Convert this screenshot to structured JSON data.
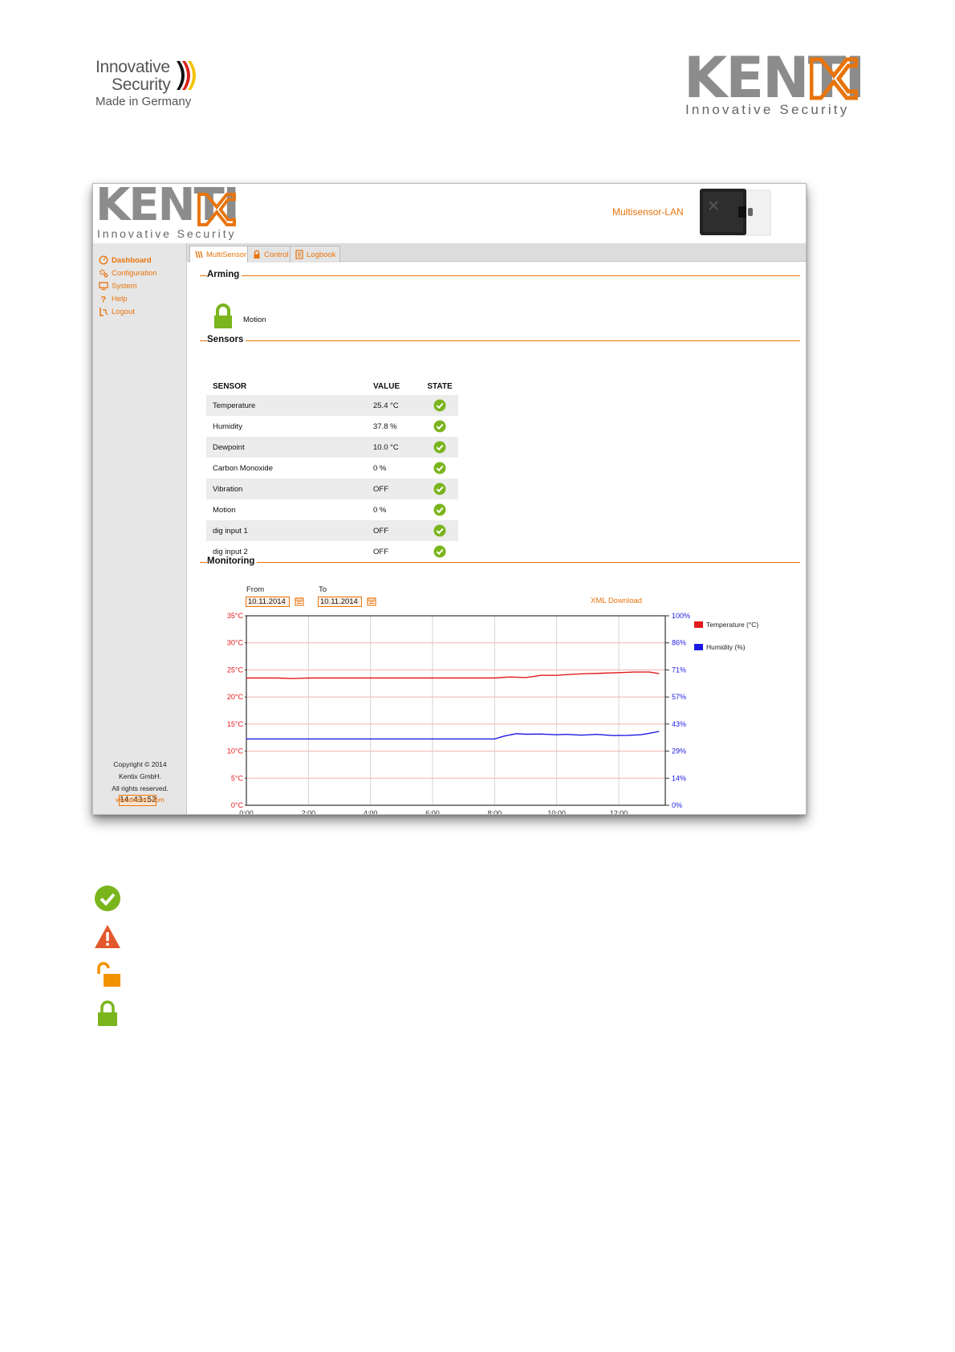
{
  "doc": {
    "left_logo": {
      "line1": "Innovative",
      "line2": "Security",
      "line3": "Made in Germany"
    },
    "right_logo": {
      "word": "KENTI",
      "tagline": "Innovative Security"
    }
  },
  "app": {
    "logo": {
      "word": "KENTI",
      "tagline": "Innovative Security"
    },
    "device_name": "Multisensor-LAN",
    "sidebar": {
      "items": [
        {
          "label": "Dashboard",
          "icon": "dashboard-icon",
          "active": true
        },
        {
          "label": "Configuration",
          "icon": "gears-icon",
          "active": false
        },
        {
          "label": "System",
          "icon": "monitor-icon",
          "active": false
        },
        {
          "label": "Help",
          "icon": "question-icon",
          "active": false
        },
        {
          "label": "Logout",
          "icon": "logout-icon",
          "active": false
        }
      ],
      "clock": "14:43:52",
      "copyright": [
        "Copyright © 2014",
        "Kentix GmbH.",
        "All rights reserved."
      ],
      "website": "www.kentix.com"
    },
    "tabs": [
      {
        "label": "MultiSensor",
        "icon": "signal-icon",
        "active": true
      },
      {
        "label": "Control",
        "icon": "lock-icon",
        "active": false
      },
      {
        "label": "Logbook",
        "icon": "book-icon",
        "active": false
      }
    ],
    "arming": {
      "title": "Arming",
      "item_label": "Motion",
      "state": "locked"
    },
    "sensors": {
      "title": "Sensors",
      "columns": [
        "SENSOR",
        "VALUE",
        "STATE"
      ],
      "rows": [
        {
          "sensor": "Temperature",
          "value": "25.4 °C",
          "state": "ok"
        },
        {
          "sensor": "Humidity",
          "value": "37.8 %",
          "state": "ok"
        },
        {
          "sensor": "Dewpoint",
          "value": "10.0 °C",
          "state": "ok"
        },
        {
          "sensor": "Carbon Monoxide",
          "value": "0 %",
          "state": "ok"
        },
        {
          "sensor": "Vibration",
          "value": "OFF",
          "state": "ok"
        },
        {
          "sensor": "Motion",
          "value": "0 %",
          "state": "ok"
        },
        {
          "sensor": "dig input 1",
          "value": "OFF",
          "state": "ok"
        },
        {
          "sensor": "dig input 2",
          "value": "OFF",
          "state": "ok"
        }
      ]
    },
    "monitoring": {
      "title": "Monitoring",
      "from_label": "From",
      "from_value": "10.11.2014",
      "to_label": "To",
      "to_value": "10.11.2014",
      "xml_download": "XML Download"
    },
    "colors": {
      "accent": "#e8740c",
      "ok_green": "#7ab51d",
      "temperature": "#e41a1c",
      "humidity": "#1a1ae4"
    }
  },
  "chart_data": {
    "type": "line",
    "x_ticks": [
      "0:00",
      "2:00",
      "4:00",
      "6:00",
      "8:00",
      "10:00",
      "12:00"
    ],
    "xlim": [
      0,
      13.5
    ],
    "y_left_ticks": [
      "0°C",
      "5°C",
      "10°C",
      "15°C",
      "20°C",
      "25°C",
      "30°C",
      "35°C"
    ],
    "y_left_lim": [
      0,
      35
    ],
    "y_right_ticks": [
      "0%",
      "14%",
      "29%",
      "43%",
      "57%",
      "71%",
      "86%",
      "100%"
    ],
    "y_right_lim": [
      0,
      100
    ],
    "grid": true,
    "legend_position": "right",
    "series": [
      {
        "name": "Temperature (°C)",
        "axis": "left",
        "color": "#e41a1c",
        "x": [
          0,
          1,
          1.5,
          2,
          3,
          4,
          5,
          6,
          7,
          8,
          8.5,
          9,
          9.5,
          10,
          10.5,
          11,
          11.5,
          12,
          12.5,
          13,
          13.3
        ],
        "y": [
          23.5,
          23.5,
          23.4,
          23.5,
          23.5,
          23.5,
          23.5,
          23.5,
          23.5,
          23.5,
          23.7,
          23.6,
          24.0,
          24.0,
          24.2,
          24.3,
          24.4,
          24.5,
          24.6,
          24.6,
          24.3
        ]
      },
      {
        "name": "Humidity (%)",
        "axis": "right",
        "color": "#1a1ae4",
        "x": [
          0,
          1,
          2,
          3,
          4,
          5,
          6,
          7,
          8,
          8.3,
          8.7,
          9,
          9.5,
          10,
          10.3,
          10.8,
          11.3,
          11.8,
          12.3,
          12.7,
          13,
          13.3
        ],
        "y": [
          35.0,
          35.0,
          35.0,
          35.0,
          35.0,
          35.0,
          35.0,
          35.0,
          35.0,
          36.5,
          37.8,
          37.5,
          37.6,
          37.2,
          37.4,
          37.0,
          37.4,
          36.8,
          36.9,
          37.2,
          38.0,
          39.0
        ]
      }
    ]
  },
  "legend_icons": [
    "check-circle-icon",
    "warning-icon",
    "unlocked-icon",
    "locked-icon"
  ]
}
